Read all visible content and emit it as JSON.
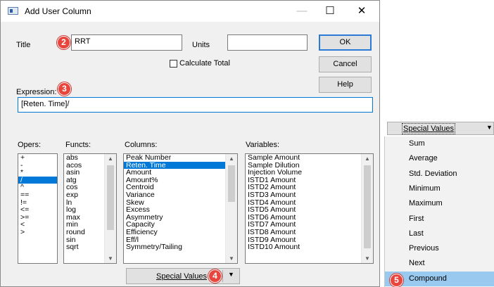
{
  "dialog": {
    "title": "Add User Column",
    "minimize": "—",
    "maximize": "☐",
    "close": "✕"
  },
  "form": {
    "title_label": "Title",
    "title_value": "RRT",
    "units_label": "Units",
    "units_value": "",
    "calc_total_label": "Calculate Total",
    "calc_total_checked": false,
    "expression_label": "Expression:",
    "expression_value": "[Reten. Time]/",
    "ok": "OK",
    "cancel": "Cancel",
    "help": "Help"
  },
  "badges": [
    "2",
    "3",
    "4",
    "5"
  ],
  "opers": {
    "label": "Opers:",
    "items": [
      "+",
      "-",
      "*",
      "/",
      "^",
      "==",
      "!=",
      "<=",
      ">=",
      "<",
      ">"
    ],
    "selected": 3
  },
  "functs": {
    "label": "Functs:",
    "items": [
      "abs",
      "acos",
      "asin",
      "atg",
      "cos",
      "exp",
      "ln",
      "log",
      "max",
      "min",
      "round",
      "sin",
      "sqrt"
    ]
  },
  "columns": {
    "label": "Columns:",
    "items": [
      "Peak Number",
      "Reten. Time",
      "Amount",
      "Amount%",
      "Centroid",
      "Variance",
      "Skew",
      "Excess",
      "Asymmetry",
      "Capacity",
      "Efficiency",
      "Eff/l",
      "Symmetry/Tailing"
    ],
    "selected": 1
  },
  "variables": {
    "label": "Variables:",
    "items": [
      "Sample Amount",
      "Sample Dilution",
      "Injection Volume",
      "ISTD1 Amount",
      "ISTD2 Amount",
      "ISTD3 Amount",
      "ISTD4 Amount",
      "ISTD5 Amount",
      "ISTD6 Amount",
      "ISTD7 Amount",
      "ISTD8 Amount",
      "ISTD9 Amount",
      "ISTD10 Amount"
    ]
  },
  "special_values": {
    "button_label": "Special Values",
    "menu_header": "Special Values",
    "menu_items": [
      "Sum",
      "Average",
      "Std. Deviation",
      "Minimum",
      "Maximum",
      "First",
      "Last",
      "Previous",
      "Next",
      "Compound"
    ],
    "selected": 9
  }
}
